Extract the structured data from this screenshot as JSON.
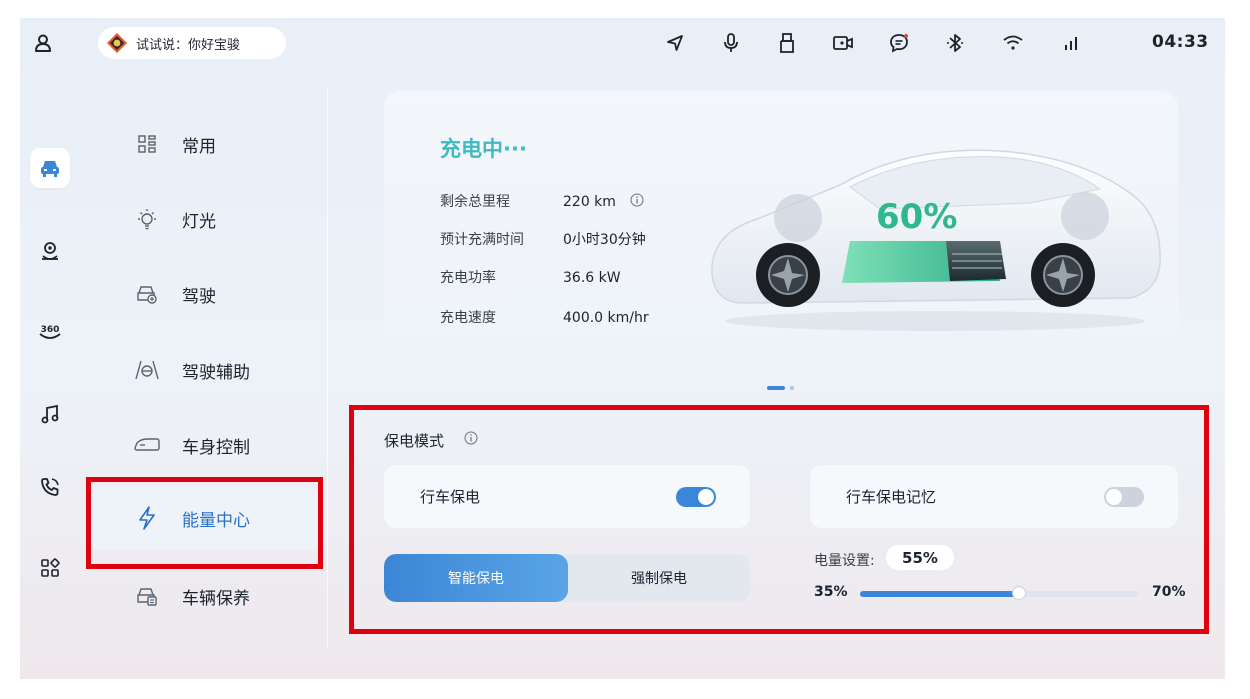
{
  "status_bar": {
    "voice_hint": "试试说：你好宝骏",
    "time": "04:33",
    "icons": [
      "user-icon",
      "navigation-icon",
      "microphone-icon",
      "usb-icon",
      "camera-icon",
      "message-icon",
      "bluetooth-icon",
      "wifi-icon",
      "signal-icon"
    ]
  },
  "rail": {
    "icons": [
      "car-icon",
      "location-pin-icon",
      "360-view-icon",
      "music-icon",
      "phone-icon",
      "apps-icon"
    ]
  },
  "menu": {
    "items": [
      {
        "label": "常用",
        "icon": "grid-icon"
      },
      {
        "label": "灯光",
        "icon": "light-bulb-icon"
      },
      {
        "label": "驾驶",
        "icon": "car-drive-icon"
      },
      {
        "label": "驾驶辅助",
        "icon": "driving-assist-icon"
      },
      {
        "label": "车身控制",
        "icon": "car-body-icon"
      },
      {
        "label": "能量中心",
        "icon": "lightning-icon"
      },
      {
        "label": "车辆保养",
        "icon": "car-maintenance-icon"
      }
    ],
    "selected": "能量中心"
  },
  "charging": {
    "title": "充电中···",
    "soc_label": "60%",
    "soc_value": 60,
    "stats": [
      {
        "label": "剩余总里程",
        "value": "220 km"
      },
      {
        "label": "预计充满时间",
        "value": "0小时30分钟"
      },
      {
        "label": "充电功率",
        "value": "36.6 kW"
      },
      {
        "label": "充电速度",
        "value": "400.0 km/hr"
      }
    ],
    "pager": {
      "count": 2,
      "active": 1
    }
  },
  "power_save": {
    "title": "保电模式",
    "drive_save_label": "行车保电",
    "drive_save_on": true,
    "memory_label": "行车保电记忆",
    "memory_on": false,
    "mode_smart": "智能保电",
    "mode_force": "强制保电",
    "selected_mode": "智能保电",
    "level_label": "电量设置:",
    "level_text": "55%",
    "level_value": 55,
    "min_text": "35%",
    "max_text": "70%",
    "min_value": 35,
    "max_value": 70
  },
  "colors": {
    "accent": "#3a86d8",
    "charging_title": "#3fb9c2",
    "soc": "#2fb88a",
    "highlight": "#e1000f"
  }
}
